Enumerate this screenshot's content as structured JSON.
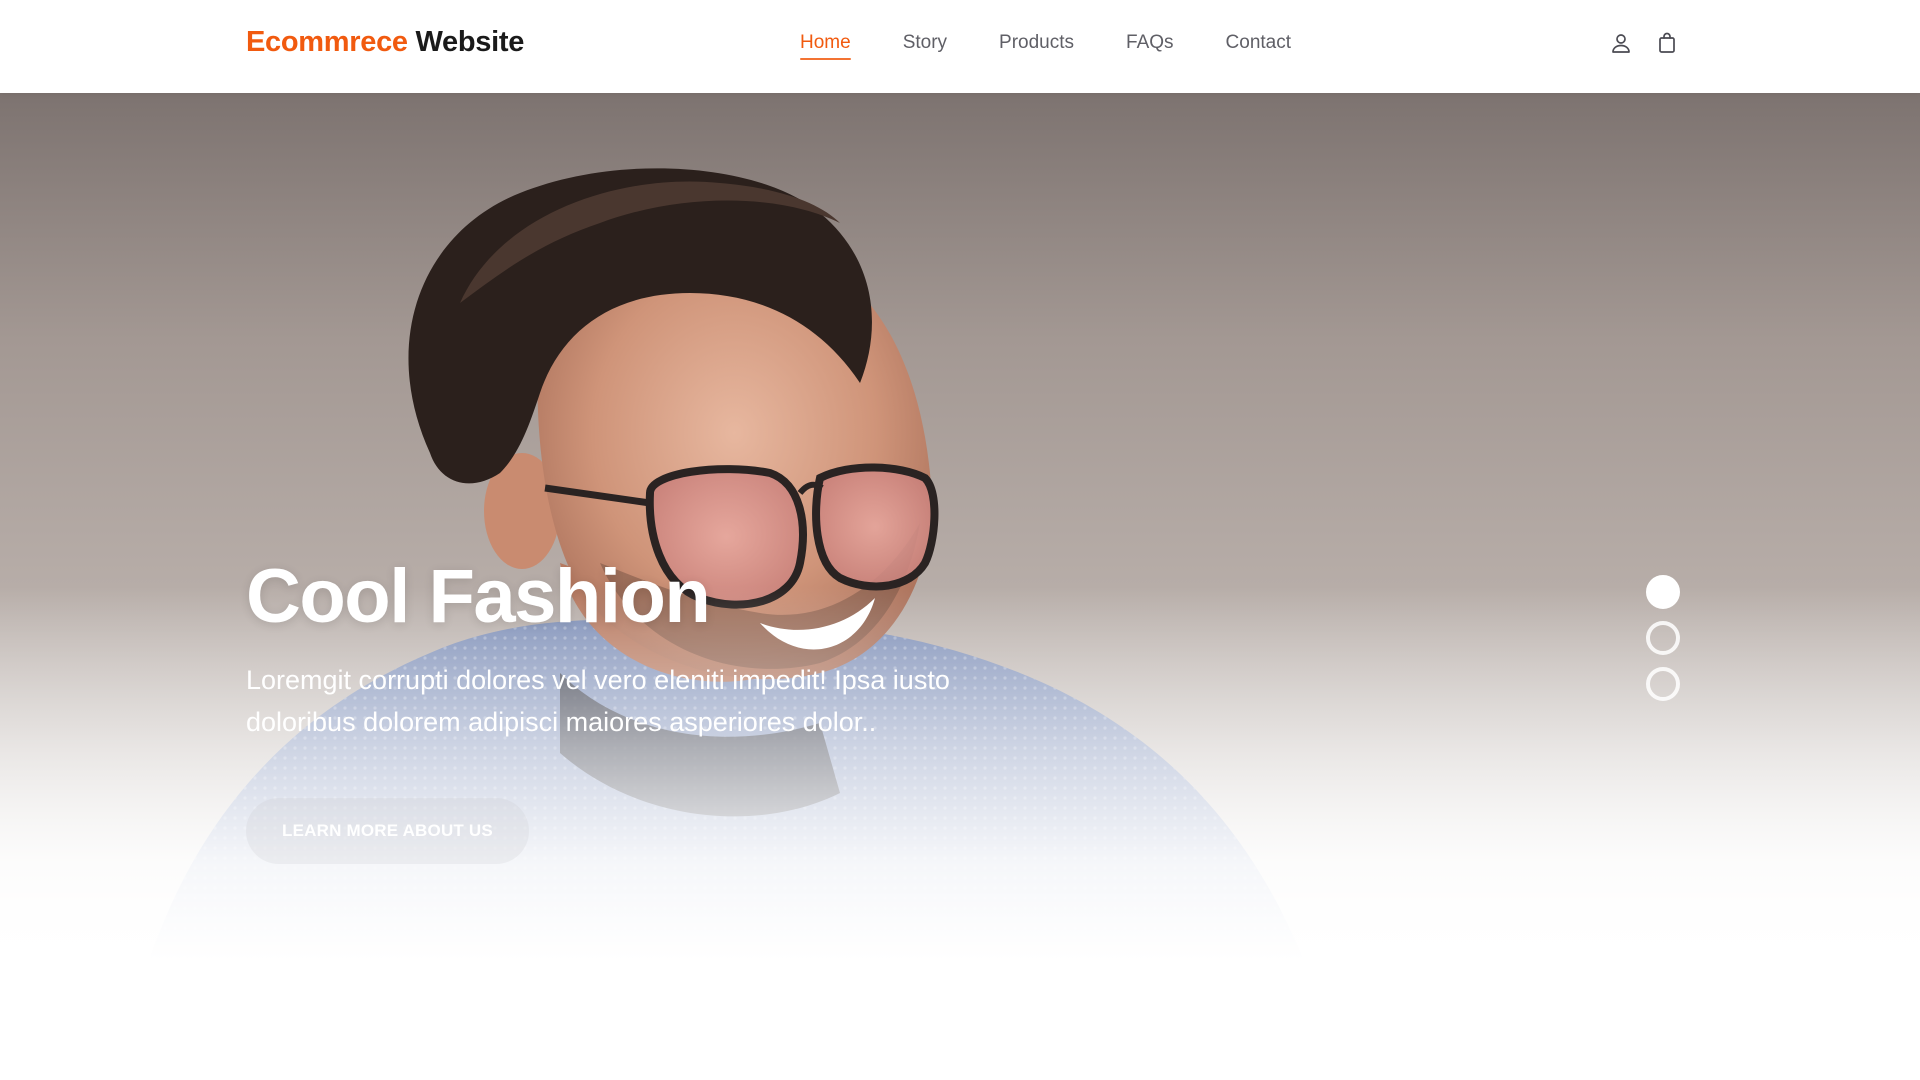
{
  "brand": {
    "accent_word": "Ecommrece",
    "rest_word": "Website",
    "accent_color": "#f15a0f"
  },
  "nav": {
    "items": [
      {
        "label": "Home",
        "active": true
      },
      {
        "label": "Story",
        "active": false
      },
      {
        "label": "Products",
        "active": false
      },
      {
        "label": "FAQs",
        "active": false
      },
      {
        "label": "Contact",
        "active": false
      }
    ]
  },
  "header_icons": [
    "user-icon",
    "shopping-bag-icon"
  ],
  "hero": {
    "title": "Cool Fashion",
    "description": "Loremgit corrupti dolores vel vero eleniti impedit! Ipsa iusto doloribus dolorem adipisci maiores asperiores dolor..",
    "cta_label": "LEARN MORE ABOUT US",
    "slides": {
      "count": 3,
      "active_index": 0
    }
  }
}
